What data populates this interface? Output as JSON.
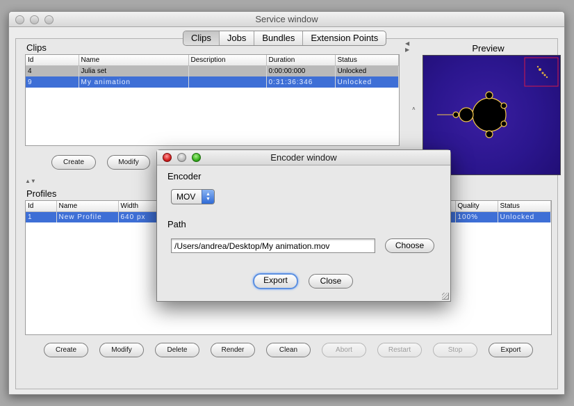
{
  "window": {
    "title": "Service window"
  },
  "tabs": [
    {
      "label": "Clips"
    },
    {
      "label": "Jobs"
    },
    {
      "label": "Bundles"
    },
    {
      "label": "Extension Points"
    }
  ],
  "clips": {
    "title": "Clips",
    "columns": [
      "Id",
      "Name",
      "Description",
      "Duration",
      "Status"
    ],
    "rows": [
      {
        "id": "4",
        "name": "Julia set",
        "description": "",
        "duration": "0:00:00:000",
        "status": "Unlocked"
      },
      {
        "id": "9",
        "name": "My animation",
        "description": "",
        "duration": "0:31:36:346",
        "status": "Unlocked"
      }
    ],
    "buttons": {
      "create": "Create",
      "modify": "Modify"
    }
  },
  "preview": {
    "title": "Preview"
  },
  "profiles": {
    "title": "Profiles",
    "columns": [
      "Id",
      "Name",
      "Width",
      "Quality",
      "Status"
    ],
    "rows": [
      {
        "id": "1",
        "name": "New Profile",
        "width": "640 px",
        "quality": "100%",
        "status": "Unlocked"
      }
    ]
  },
  "bottom_buttons": {
    "create": "Create",
    "modify": "Modify",
    "delete": "Delete",
    "render": "Render",
    "clean": "Clean",
    "abort": "Abort",
    "restart": "Restart",
    "stop": "Stop",
    "export": "Export"
  },
  "encoder_dialog": {
    "title": "Encoder window",
    "encoder_label": "Encoder",
    "encoder_value": "MOV",
    "path_label": "Path",
    "path_value": "/Users/andrea/Desktop/My animation.mov",
    "choose": "Choose",
    "export": "Export",
    "close": "Close"
  },
  "colors": {
    "selection": "#3e6fd6",
    "locked_row": "#b9b9b9",
    "preview_bg": "#2b168e"
  }
}
